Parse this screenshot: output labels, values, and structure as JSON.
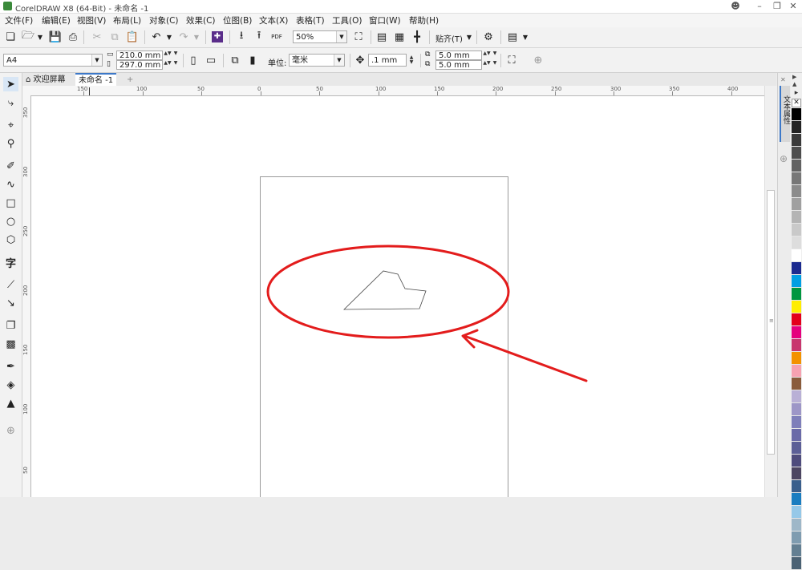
{
  "title_bar": {
    "title": "CorelDRAW X8 (64-Bit) - 未命名 -1"
  },
  "menu": [
    "文件(F)",
    "编辑(E)",
    "视图(V)",
    "布局(L)",
    "对象(C)",
    "效果(C)",
    "位图(B)",
    "文本(X)",
    "表格(T)",
    "工具(O)",
    "窗口(W)",
    "帮助(H)"
  ],
  "standard_toolbar": {
    "zoom": "50%",
    "snap_label": "贴齐(T)",
    "pdf_label": "PDF"
  },
  "property_bar": {
    "page_size": "A4",
    "width": "210.0 mm",
    "height": "297.0 mm",
    "units_label": "单位:",
    "units_value": "毫米",
    "nudge": ".1 mm",
    "dup_x": "5.0 mm",
    "dup_y": "5.0 mm"
  },
  "tabs": [
    {
      "label": "欢迎屏幕",
      "active": false
    },
    {
      "label": "未命名 -1",
      "active": true
    }
  ],
  "ruler": {
    "h_labels": [
      "150",
      "100",
      "50",
      "0",
      "50",
      "100",
      "150",
      "200",
      "250",
      "300",
      "350",
      "400"
    ],
    "v_labels": [
      "350",
      "300",
      "250",
      "200",
      "150",
      "100",
      "50"
    ]
  },
  "docker_label": "文本属性",
  "palette_colors": [
    "#000000",
    "#242424",
    "#3a3a3a",
    "#4d4d4d",
    "#626262",
    "#777777",
    "#8b8b8b",
    "#a0a0a0",
    "#b4b4b4",
    "#c9c9c9",
    "#dddddd",
    "#ffffff",
    "#1b2a8f",
    "#009fe3",
    "#00963f",
    "#ffed00",
    "#e3001b",
    "#e5007e",
    "#c8366e",
    "#f39200",
    "#f6a2b1",
    "#8a5c3c",
    "#b9b0d6",
    "#9d96c7",
    "#7f7fba",
    "#6a6aa8",
    "#5c5f97",
    "#4f4c7d",
    "#4d4662",
    "#3a5f8c",
    "#1a7dc0",
    "#95c8e8",
    "#9eb7c8",
    "#7f9cb0",
    "#637f92",
    "#4b6274"
  ],
  "drawing": {
    "ellipse_color": "#e31c1c",
    "arrow_color": "#e31c1c"
  }
}
